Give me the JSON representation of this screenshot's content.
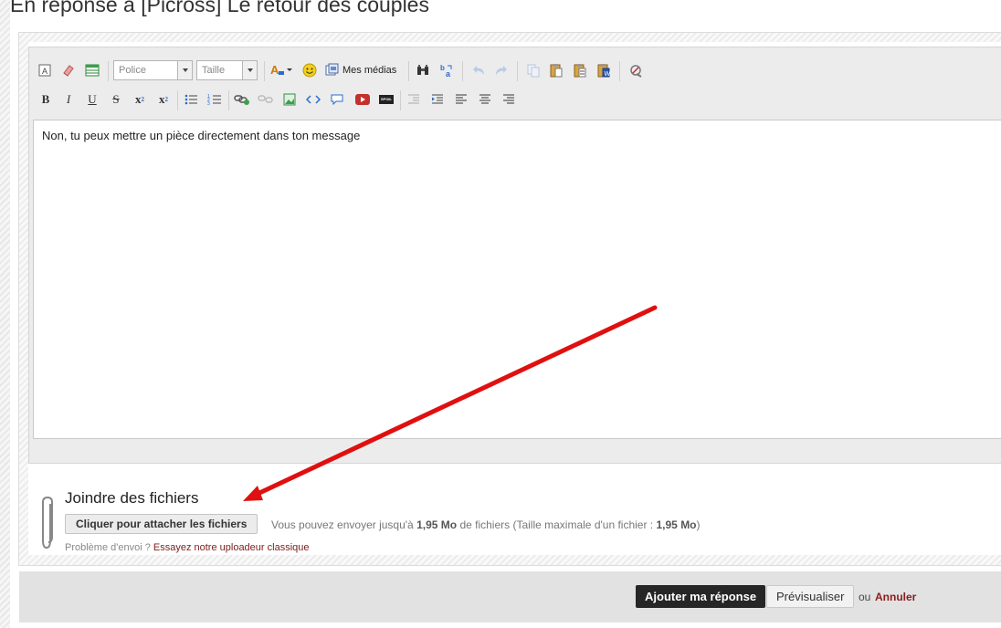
{
  "page": {
    "title": "En réponse à [Picross] Le retour des couples"
  },
  "toolbar": {
    "font_combo": "Police",
    "size_combo": "Taille",
    "media_label": "Mes médias",
    "bold": "B",
    "italic": "I",
    "underline": "U",
    "strike": "S",
    "subscript": "x",
    "superscript": "x",
    "spoil": "SPOIL"
  },
  "editor": {
    "content": "Non, tu peux mettre un pièce directement dans ton message"
  },
  "attachments": {
    "title": "Joindre des fichiers",
    "button_label": "Cliquer pour attacher les fichiers",
    "info_prefix": "Vous pouvez envoyer jusqu'à",
    "max_total": "1,95 Mo",
    "info_middle": "de fichiers (Taille maximale d'un fichier :",
    "max_file": "1,95 Mo",
    "info_suffix": ")",
    "problem_prefix": "Problème d'envoi ?",
    "problem_link": "Essayez notre uploadeur classique"
  },
  "footer": {
    "submit_label": "Ajouter ma réponse",
    "preview_label": "Prévisualiser",
    "or_text": "ou",
    "cancel_label": "Annuler"
  },
  "colors": {
    "annotation_arrow": "#e01010",
    "cancel_link": "#8a1d1d",
    "submit_bg": "#262626"
  }
}
